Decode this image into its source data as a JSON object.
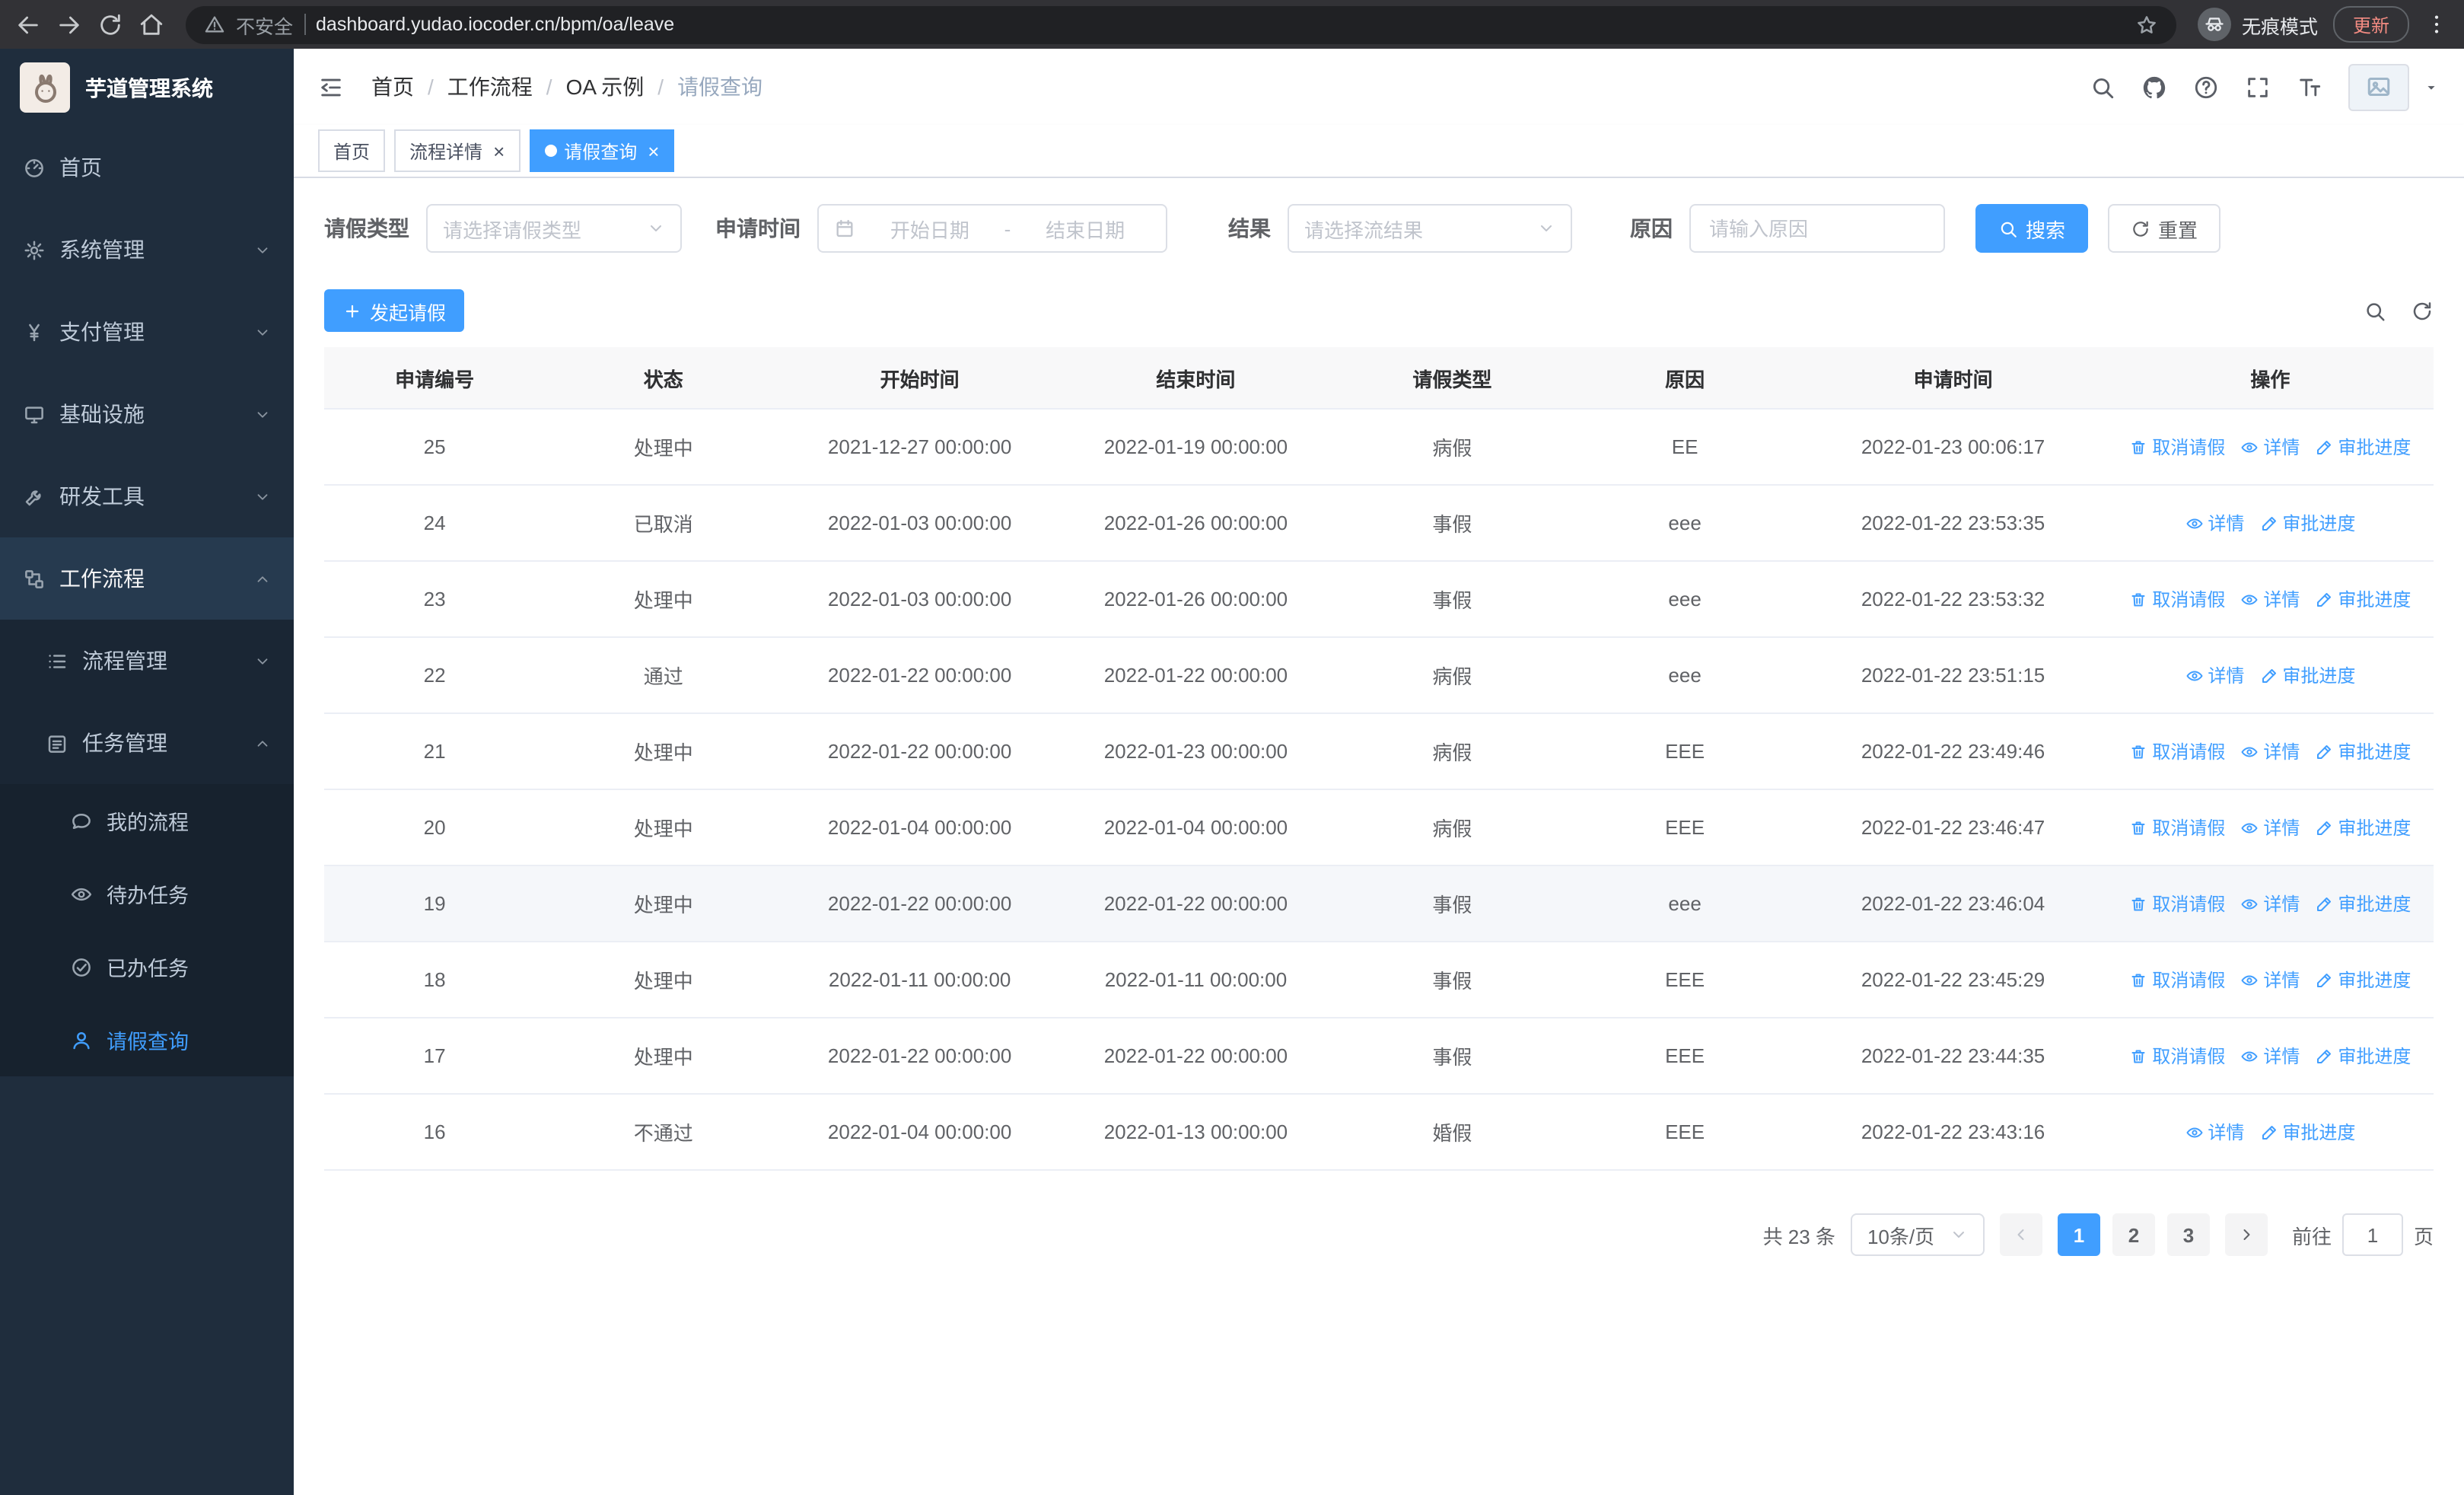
{
  "browser": {
    "security_label": "不安全",
    "url": "dashboard.yudao.iocoder.cn/bpm/oa/leave",
    "incognito_label": "无痕模式",
    "update_label": "更新"
  },
  "sidebar": {
    "logo_title": "芋道管理系统",
    "items": [
      {
        "key": "home",
        "label": "首页",
        "icon": "dashboard",
        "level": 1
      },
      {
        "key": "system-management",
        "label": "系统管理",
        "icon": "gear",
        "level": 1,
        "expandable": true
      },
      {
        "key": "payment-management",
        "label": "支付管理",
        "icon": "yen",
        "level": 1,
        "expandable": true
      },
      {
        "key": "infrastructure",
        "label": "基础设施",
        "icon": "monitor",
        "level": 1,
        "expandable": true
      },
      {
        "key": "dev-tools",
        "label": "研发工具",
        "icon": "tool",
        "level": 1,
        "expandable": true
      },
      {
        "key": "workflow",
        "label": "工作流程",
        "icon": "workflow",
        "level": 1,
        "expandable": true,
        "expanded": true
      },
      {
        "key": "process-management",
        "label": "流程管理",
        "icon": "list",
        "level": 2,
        "expandable": true
      },
      {
        "key": "task-management",
        "label": "任务管理",
        "icon": "tasks",
        "level": 2,
        "expandable": true,
        "expanded": true
      },
      {
        "key": "my-process",
        "label": "我的流程",
        "icon": "chat",
        "level": 3
      },
      {
        "key": "todo-tasks",
        "label": "待办任务",
        "icon": "eye",
        "level": 3
      },
      {
        "key": "done-tasks",
        "label": "已办任务",
        "icon": "done",
        "level": 3
      },
      {
        "key": "leave-query",
        "label": "请假查询",
        "icon": "user",
        "level": 3,
        "active": true
      }
    ]
  },
  "header": {
    "breadcrumb": [
      "首页",
      "工作流程",
      "OA 示例",
      "请假查询"
    ]
  },
  "tabs": [
    {
      "key": "home",
      "label": "首页",
      "closable": false,
      "active": false
    },
    {
      "key": "process-detail",
      "label": "流程详情",
      "closable": true,
      "active": false
    },
    {
      "key": "leave-query",
      "label": "请假查询",
      "closable": true,
      "active": true
    }
  ],
  "filters": {
    "leave_type_label": "请假类型",
    "leave_type_placeholder": "请选择请假类型",
    "apply_time_label": "申请时间",
    "start_date_placeholder": "开始日期",
    "range_separator": "-",
    "end_date_placeholder": "结束日期",
    "result_label": "结果",
    "result_placeholder": "请选择流结果",
    "reason_label": "原因",
    "reason_placeholder": "请输入原因",
    "search_button": "搜索",
    "reset_button": "重置"
  },
  "toolbar": {
    "create_button": "发起请假"
  },
  "table": {
    "columns": [
      "申请编号",
      "状态",
      "开始时间",
      "结束时间",
      "请假类型",
      "原因",
      "申请时间",
      "操作"
    ],
    "action_labels": {
      "cancel": "取消请假",
      "detail": "详情",
      "progress": "审批进度"
    },
    "rows": [
      {
        "id": "25",
        "status": "处理中",
        "start": "2021-12-27 00:00:00",
        "end": "2022-01-19 00:00:00",
        "type": "病假",
        "reason": "EE",
        "apply_time": "2022-01-23 00:06:17",
        "actions": [
          "cancel",
          "detail",
          "progress"
        ],
        "highlighted": false
      },
      {
        "id": "24",
        "status": "已取消",
        "start": "2022-01-03 00:00:00",
        "end": "2022-01-26 00:00:00",
        "type": "事假",
        "reason": "eee",
        "apply_time": "2022-01-22 23:53:35",
        "actions": [
          "detail",
          "progress"
        ],
        "highlighted": false
      },
      {
        "id": "23",
        "status": "处理中",
        "start": "2022-01-03 00:00:00",
        "end": "2022-01-26 00:00:00",
        "type": "事假",
        "reason": "eee",
        "apply_time": "2022-01-22 23:53:32",
        "actions": [
          "cancel",
          "detail",
          "progress"
        ],
        "highlighted": false
      },
      {
        "id": "22",
        "status": "通过",
        "start": "2022-01-22 00:00:00",
        "end": "2022-01-22 00:00:00",
        "type": "病假",
        "reason": "eee",
        "apply_time": "2022-01-22 23:51:15",
        "actions": [
          "detail",
          "progress"
        ],
        "highlighted": false
      },
      {
        "id": "21",
        "status": "处理中",
        "start": "2022-01-22 00:00:00",
        "end": "2022-01-23 00:00:00",
        "type": "病假",
        "reason": "EEE",
        "apply_time": "2022-01-22 23:49:46",
        "actions": [
          "cancel",
          "detail",
          "progress"
        ],
        "highlighted": false
      },
      {
        "id": "20",
        "status": "处理中",
        "start": "2022-01-04 00:00:00",
        "end": "2022-01-04 00:00:00",
        "type": "病假",
        "reason": "EEE",
        "apply_time": "2022-01-22 23:46:47",
        "actions": [
          "cancel",
          "detail",
          "progress"
        ],
        "highlighted": false
      },
      {
        "id": "19",
        "status": "处理中",
        "start": "2022-01-22 00:00:00",
        "end": "2022-01-22 00:00:00",
        "type": "事假",
        "reason": "eee",
        "apply_time": "2022-01-22 23:46:04",
        "actions": [
          "cancel",
          "detail",
          "progress"
        ],
        "highlighted": true
      },
      {
        "id": "18",
        "status": "处理中",
        "start": "2022-01-11 00:00:00",
        "end": "2022-01-11 00:00:00",
        "type": "事假",
        "reason": "EEE",
        "apply_time": "2022-01-22 23:45:29",
        "actions": [
          "cancel",
          "detail",
          "progress"
        ],
        "highlighted": false
      },
      {
        "id": "17",
        "status": "处理中",
        "start": "2022-01-22 00:00:00",
        "end": "2022-01-22 00:00:00",
        "type": "事假",
        "reason": "EEE",
        "apply_time": "2022-01-22 23:44:35",
        "actions": [
          "cancel",
          "detail",
          "progress"
        ],
        "highlighted": false
      },
      {
        "id": "16",
        "status": "不通过",
        "start": "2022-01-04 00:00:00",
        "end": "2022-01-13 00:00:00",
        "type": "婚假",
        "reason": "EEE",
        "apply_time": "2022-01-22 23:43:16",
        "actions": [
          "detail",
          "progress"
        ],
        "highlighted": false
      }
    ]
  },
  "pagination": {
    "total_text": "共 23 条",
    "page_size_text": "10条/页",
    "pages": [
      "1",
      "2",
      "3"
    ],
    "active_page": "1",
    "goto_prefix": "前往",
    "goto_value": "1",
    "goto_suffix": "页"
  },
  "colors": {
    "primary": "#409eff",
    "sidebar_bg": "#1f2d3d"
  }
}
